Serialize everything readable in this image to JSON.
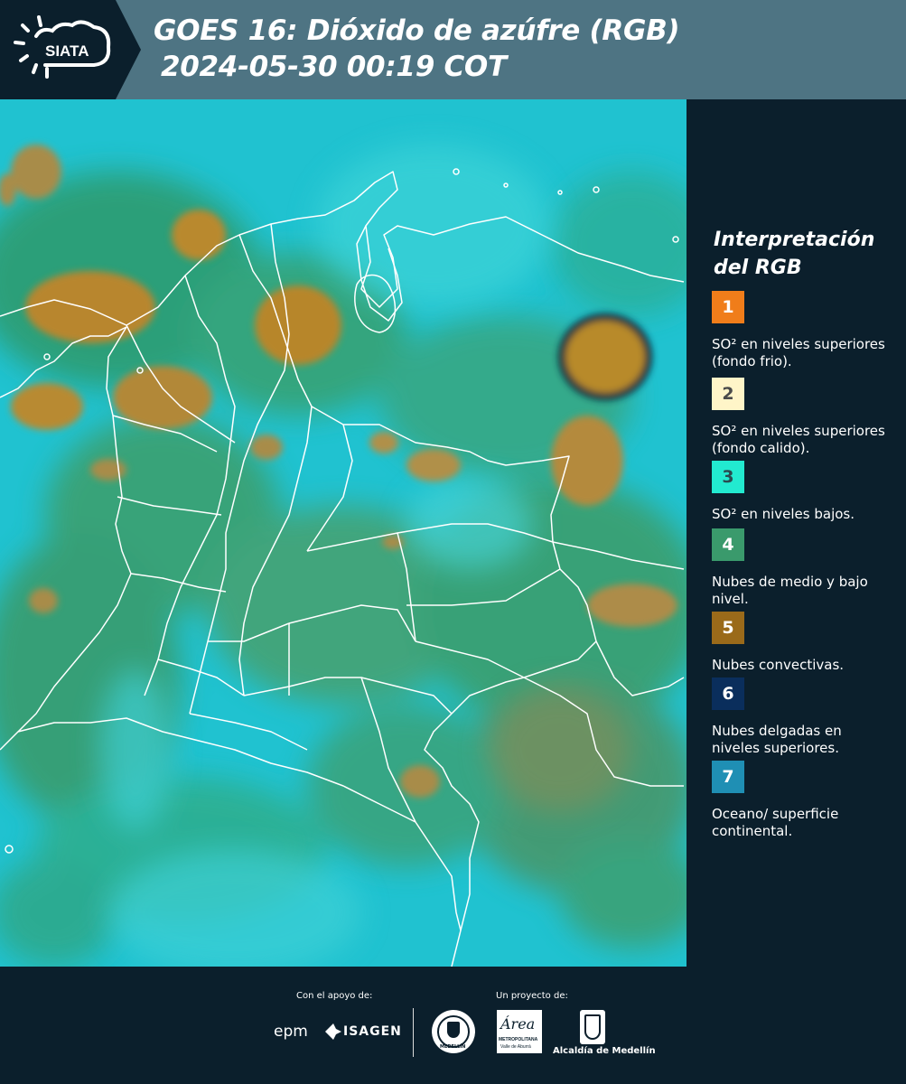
{
  "header": {
    "logo_text": "SIATA",
    "title_line1": "GOES 16: Dióxido de azúfre (RGB)",
    "title_line2": "2024-05-30 00:19 COT",
    "background_color": "#4e7483"
  },
  "legend": {
    "title": "Interpretación del RGB",
    "items": [
      {
        "number": "1",
        "color": "#f07d1a",
        "number_color": "#ffffff",
        "description": "SO² en niveles superiores (fondo frio)."
      },
      {
        "number": "2",
        "color": "#fff5c8",
        "number_color": "#4a4a4a",
        "description": "SO² en niveles superiores (fondo calido)."
      },
      {
        "number": "3",
        "color": "#22ead0",
        "number_color": "#2a4a50",
        "description": "SO² en niveles bajos."
      },
      {
        "number": "4",
        "color": "#3a9a6c",
        "number_color": "#ffffff",
        "description": "Nubes de medio y bajo nivel."
      },
      {
        "number": "5",
        "color": "#9a6a1a",
        "number_color": "#ffffff",
        "description": "Nubes convectivas."
      },
      {
        "number": "6",
        "color": "#0a2e5c",
        "number_color": "#ffffff",
        "description": "Nubes delgadas en niveles superiores."
      },
      {
        "number": "7",
        "color": "#1f8fb4",
        "number_color": "#ffffff",
        "description": "Oceano/ superficie continental."
      }
    ]
  },
  "footer": {
    "support_label": "Con el apoyo de:",
    "project_label": "Un proyecto de:",
    "sponsor_epm": "epm",
    "sponsor_isagen": "ISAGEN",
    "seal_caption": "MEDELLÍN",
    "area_logo_text": "Área",
    "area_caption_1": "METROPOLITANA",
    "area_caption_2": "Valle de Aburrá",
    "alcaldia_caption": "Alcaldía de Medellín"
  }
}
